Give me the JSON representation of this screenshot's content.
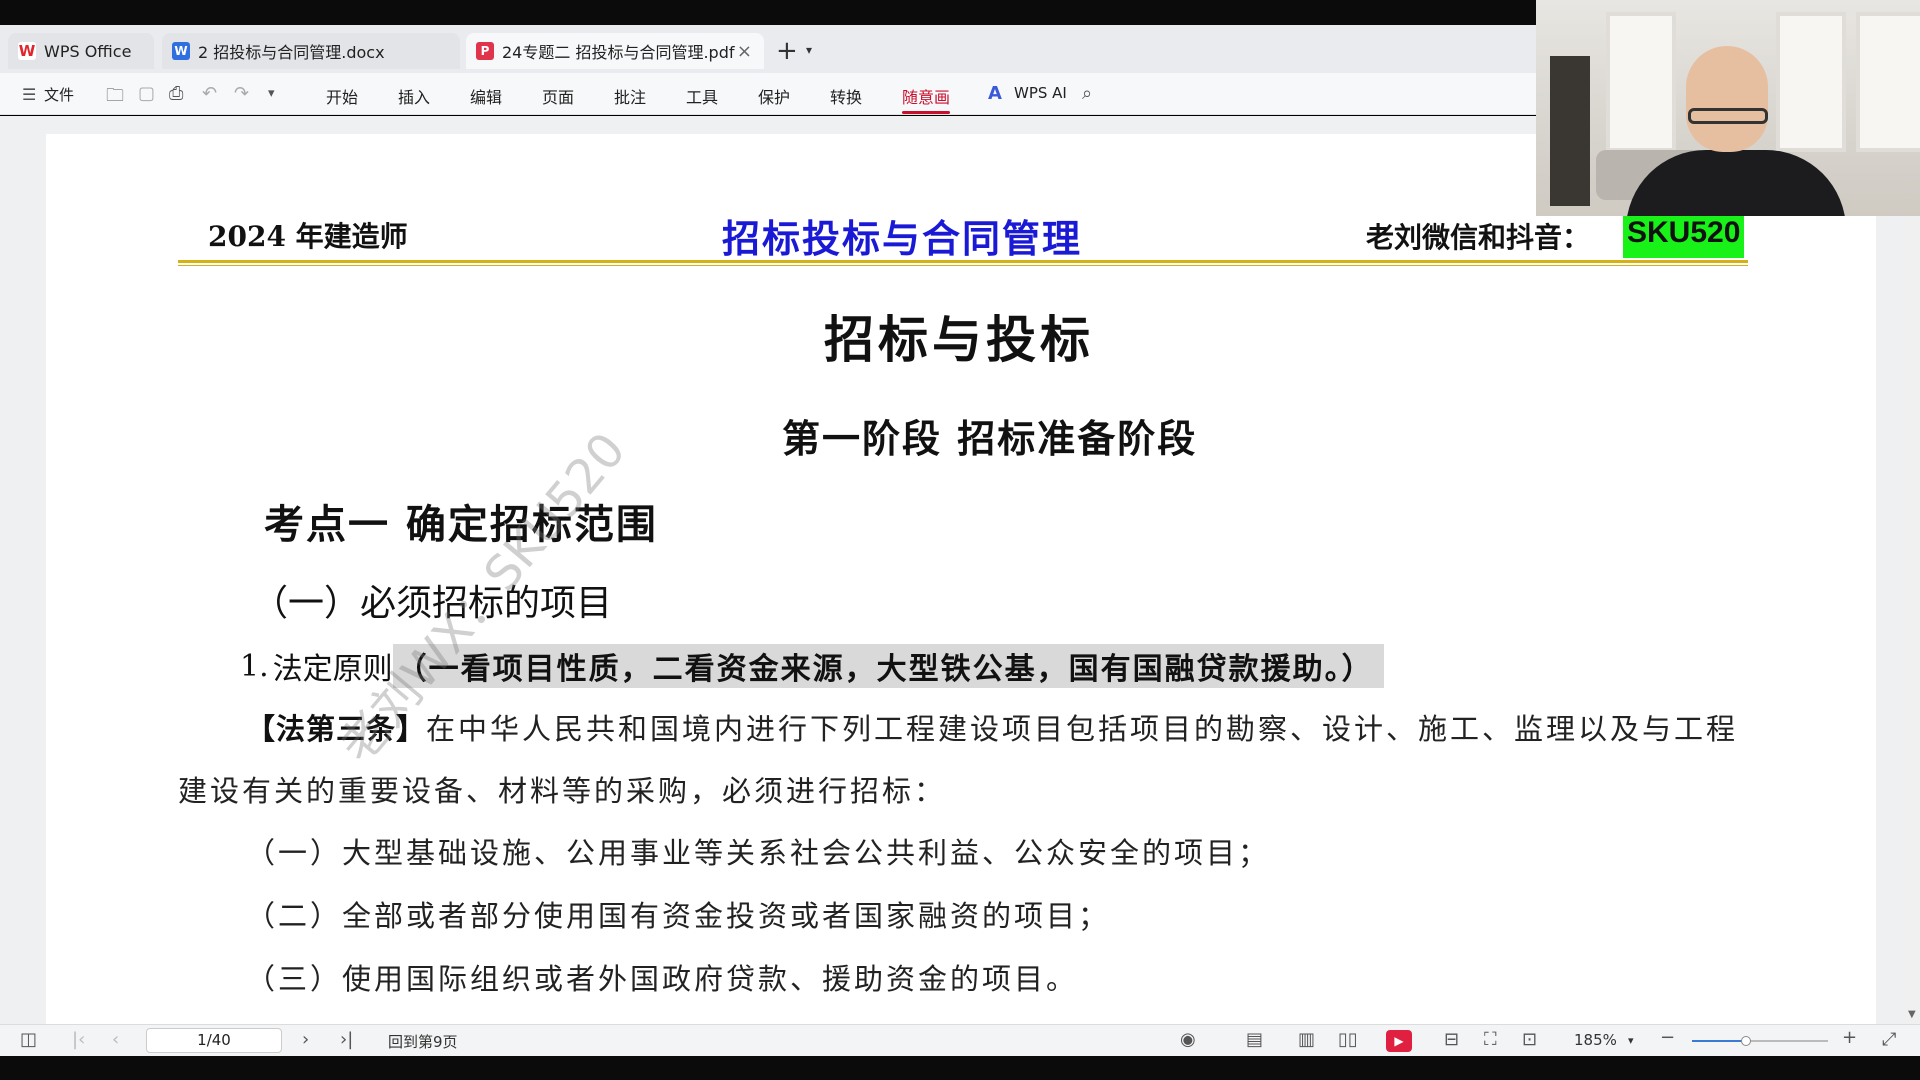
{
  "tabs": [
    {
      "label": "WPS Office",
      "icon": "wps-logo-icon"
    },
    {
      "label": "2 招投标与合同管理.docx",
      "icon": "word-doc-icon"
    },
    {
      "label": "24专题二 招投标与合同管理.pdf",
      "icon": "pdf-doc-icon",
      "active": true
    }
  ],
  "menu": {
    "file_label": "文件",
    "items": [
      "开始",
      "插入",
      "编辑",
      "页面",
      "批注",
      "工具",
      "保护",
      "转换",
      "随意画"
    ],
    "active_item": "随意画",
    "ai_label": "WPS AI"
  },
  "document": {
    "header_left": "2024 年建造师",
    "header_center": "招标投标与合同管理",
    "header_right": "老刘微信和抖音：",
    "header_code": "SKU520",
    "title": "招标与投标",
    "stage": "第一阶段  招标准备阶段",
    "point": "考点一  确定招标范围",
    "subsection": "（一）必须招标的项目",
    "rule_num": "1.",
    "rule_label": "法定原则",
    "rule_highlight": "（一看项目性质，二看资金来源，大型铁公基，国有国融贷款援助。）",
    "article_label": "【法第三条】",
    "article_text_1": "在中华人民共和国境内进行下列工程建设项目包括项目的勘察、设计、施工、监理以及与工程",
    "article_text_2": "建设有关的重要设备、材料等的采购，必须进行招标：",
    "item_1": "（一）大型基础设施、公用事业等关系社会公共利益、公众安全的项目；",
    "item_2": "（二）全部或者部分使用国有资金投资或者国家融资的项目；",
    "item_3": "（三）使用国际组织或者外国政府贷款、援助资金的项目。",
    "watermark": "老刘WX：SKU520"
  },
  "status": {
    "page_indicator": "1/40",
    "back_label": "回到第9页",
    "zoom": "185%",
    "zoom_fraction": 0.4
  },
  "colors": {
    "header_center": "#1a1ad6",
    "code_highlight": "#19f219",
    "accent": "#c8102e",
    "rule_gold": "#d4b216"
  }
}
